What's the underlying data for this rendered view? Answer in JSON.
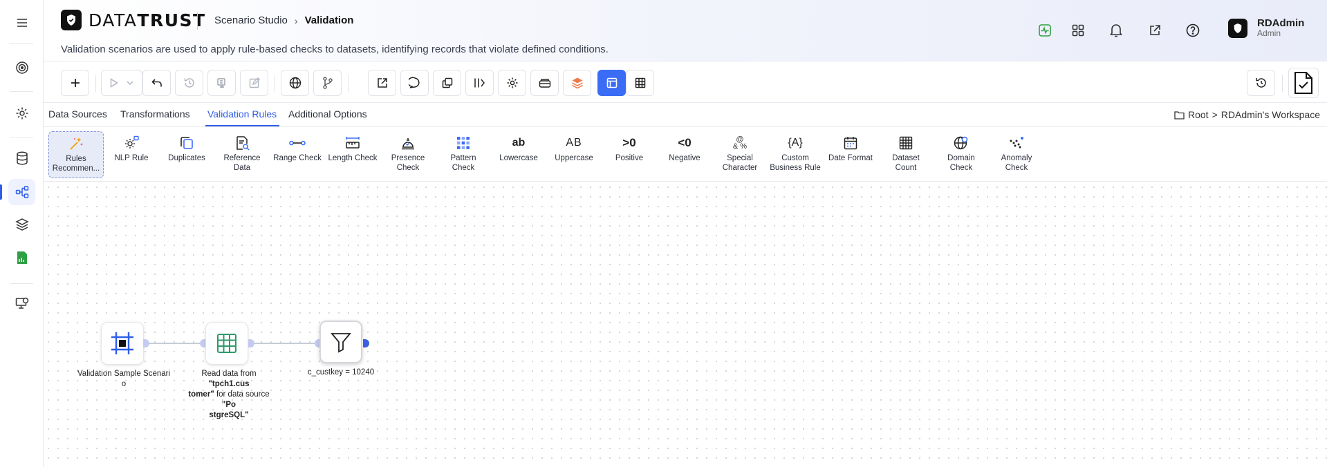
{
  "app": {
    "logo_text_light": "DATA",
    "logo_text_bold": "TRUST"
  },
  "breadcrumb": {
    "parent": "Scenario Studio",
    "current": "Validation"
  },
  "description": "Validation scenarios are used to apply rule-based checks to datasets, identifying records that violate defined conditions.",
  "user": {
    "name": "RDAdmin",
    "role": "Admin"
  },
  "header_icons": [
    "activity-icon",
    "apps-grid-icon",
    "bell-icon",
    "external-link-icon",
    "help-icon"
  ],
  "sidebar": {
    "items": [
      "menu-icon",
      "target-icon",
      "settings-icon",
      "database-icon",
      "workflow-icon",
      "layers-icon",
      "report-icon",
      "monitor-icon"
    ],
    "active": "workflow-icon"
  },
  "toolbar": {
    "buttons": [
      "add",
      "run",
      "run-dropdown",
      "undo",
      "history",
      "save-template",
      "edit",
      "globe",
      "branch",
      "export",
      "comment",
      "duplicate",
      "split-view",
      "settings",
      "package",
      "layers-stack",
      "layout-view",
      "table-view"
    ],
    "active": "layout-view",
    "right": [
      "restore-version",
      "validate-document"
    ]
  },
  "tabs": {
    "items": [
      "Data Sources",
      "Transformations",
      "Validation Rules",
      "Additional Options"
    ],
    "active": "Validation Rules"
  },
  "workspace": {
    "root": "Root",
    "sep": ">",
    "name": "RDAdmin's Workspace"
  },
  "palette": [
    {
      "line1": "Rules",
      "line2": "Recommen..."
    },
    {
      "line1": "NLP Rule",
      "line2": ""
    },
    {
      "line1": "Duplicates",
      "line2": ""
    },
    {
      "line1": "Reference",
      "line2": "Data"
    },
    {
      "line1": "Range Check",
      "line2": ""
    },
    {
      "line1": "Length Check",
      "line2": ""
    },
    {
      "line1": "Presence",
      "line2": "Check"
    },
    {
      "line1": "Pattern",
      "line2": "Check"
    },
    {
      "line1": "Lowercase",
      "line2": ""
    },
    {
      "line1": "Uppercase",
      "line2": ""
    },
    {
      "line1": "Positive",
      "line2": ""
    },
    {
      "line1": "Negative",
      "line2": ""
    },
    {
      "line1": "Special",
      "line2": "Character"
    },
    {
      "line1": "Custom",
      "line2": "Business Rule"
    },
    {
      "line1": "Date Format",
      "line2": ""
    },
    {
      "line1": "Dataset",
      "line2": "Count"
    },
    {
      "line1": "Domain",
      "line2": "Check"
    },
    {
      "line1": "Anomaly",
      "line2": "Check"
    }
  ],
  "palette_glyphs": {
    "lowercase": "ab",
    "uppercase": "AB",
    "positive": ">0",
    "negative": "<0",
    "special": "@& %",
    "custom": "{A}"
  },
  "flow": {
    "node1": {
      "label_l1": "Validation Sample Scenari",
      "label_l2": "o"
    },
    "node2": {
      "l1_pre": "Read data from ",
      "l1_bold": "\"tpch1.cus",
      "l2_bold": "tomer\"",
      "l2_mid": " for data source ",
      "l2_bold2": "\"Po",
      "l3_bold": "stgreSQL\""
    },
    "node3": {
      "label": "c_custkey = 10240"
    }
  }
}
